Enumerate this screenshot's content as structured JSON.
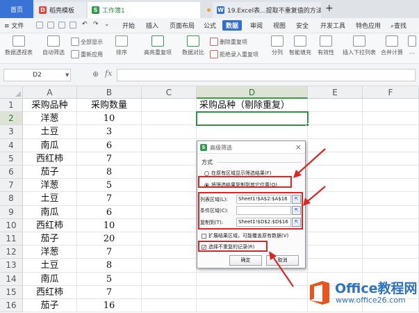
{
  "tabs": {
    "home": "首页",
    "template": "稻壳模板",
    "workbook": "工作簿1",
    "word_doc": "19.Excel表...提取不重复值的方法",
    "add": "+"
  },
  "menu": {
    "file": "文件",
    "items": [
      "开始",
      "插入",
      "页面布局",
      "公式",
      "数据",
      "审阅",
      "视图",
      "安全",
      "开发工具",
      "特色应用"
    ],
    "active": "数据",
    "search": "查找"
  },
  "ribbon": {
    "pivot": "数据透视表",
    "auto_filter": "自动筛选",
    "show_all": "全部显示",
    "reapply": "重新应用",
    "sort": "排序",
    "highlight_dup": "高亮重复项",
    "compare": "数据对比",
    "delete_dup": "删除重复项",
    "reject_dup": "拒绝录入重复项",
    "split": "分列",
    "smart_fill": "智能填充",
    "validity": "有效性",
    "insert_dropdown": "插入下拉列表",
    "consolidate": "合并计算",
    "more": "..."
  },
  "formula_bar": {
    "name_box": "D2",
    "fx": "fx",
    "formula": ""
  },
  "sheet": {
    "columns": [
      "A",
      "B",
      "C",
      "D",
      "E",
      "F"
    ],
    "rows": [
      "1",
      "2",
      "3",
      "4",
      "5",
      "6",
      "7",
      "8",
      "9",
      "10",
      "11",
      "12",
      "13",
      "14",
      "15",
      "16"
    ],
    "header_a": "采购品种",
    "header_b": "采购数量",
    "header_d": "采购品种（剔除重复）",
    "data": [
      [
        "洋葱",
        "10"
      ],
      [
        "土豆",
        "3"
      ],
      [
        "南瓜",
        "6"
      ],
      [
        "西红柿",
        "7"
      ],
      [
        "茄子",
        "8"
      ],
      [
        "洋葱",
        "5"
      ],
      [
        "土豆",
        "7"
      ],
      [
        "南瓜",
        "6"
      ],
      [
        "西红柿",
        "10"
      ],
      [
        "茄子",
        "20"
      ],
      [
        "洋葱",
        "7"
      ],
      [
        "土豆",
        "8"
      ],
      [
        "南瓜",
        "5"
      ],
      [
        "西红柿",
        "7"
      ],
      [
        "茄子",
        "16"
      ]
    ]
  },
  "dialog": {
    "title": "高级筛选",
    "close": "×",
    "section": "方式",
    "option_in_place": "在原有区域显示筛选结果(F)",
    "option_copy": "将筛选结果复制到其它位置(O)",
    "list_range_label": "列表区域(L):",
    "list_range_value": "Sheet1!$A$2:$A$16",
    "criteria_label": "条件区域(C):",
    "criteria_value": "",
    "copy_to_label": "复制到(T):",
    "copy_to_value": "Sheet1!$D$2:$D$16",
    "expand_label": "扩展结果区域，可能覆盖原有数据(V)",
    "unique_label": "选择不重复的记录(R)",
    "ok": "确定",
    "cancel": "取消"
  },
  "watermark": {
    "brand": "Office教程网",
    "url": "www.office26.com"
  },
  "colors": {
    "accent_green": "#2f8f45",
    "accent_blue": "#2f6fd1",
    "highlight_red": "#e02424",
    "brand_orange": "#e8541c"
  }
}
